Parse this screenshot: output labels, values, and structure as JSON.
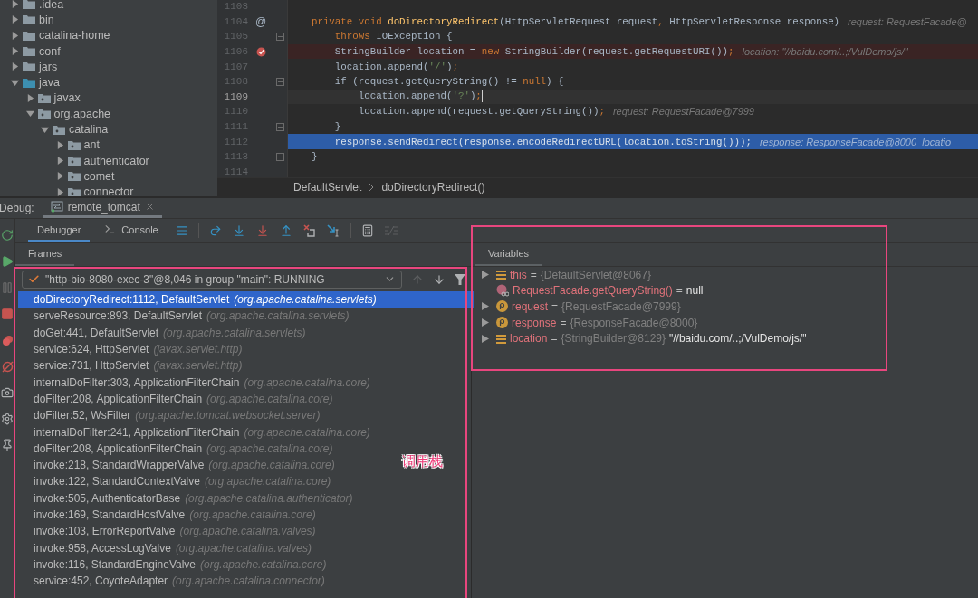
{
  "project_tree": [
    {
      "label": ".idea",
      "kind": "plain",
      "expanded": false
    },
    {
      "label": "bin",
      "kind": "plain",
      "expanded": false
    },
    {
      "label": "catalina-home",
      "kind": "plain",
      "expanded": false
    },
    {
      "label": "conf",
      "kind": "plain",
      "expanded": false
    },
    {
      "label": "jars",
      "kind": "plain",
      "expanded": false
    },
    {
      "label": "java",
      "kind": "source",
      "expanded": true,
      "children": [
        {
          "label": "javax",
          "kind": "package",
          "expanded": false
        },
        {
          "label": "org.apache",
          "kind": "package",
          "expanded": true,
          "children": [
            {
              "label": "catalina",
              "kind": "package",
              "expanded": true,
              "children": [
                {
                  "label": "ant",
                  "kind": "package",
                  "expanded": false
                },
                {
                  "label": "authenticator",
                  "kind": "package",
                  "expanded": false
                },
                {
                  "label": "comet",
                  "kind": "package",
                  "expanded": false
                },
                {
                  "label": "connector",
                  "kind": "package",
                  "expanded": false
                }
              ]
            }
          ]
        }
      ]
    }
  ],
  "editor": {
    "lines": [
      {
        "number": "1103",
        "execution": false,
        "caret": false,
        "breakpoint": false,
        "fold": false
      },
      {
        "number": "1104",
        "execution": false,
        "caret": false,
        "breakpoint": false,
        "fold": false,
        "gutter_mark": "@",
        "tokens": [
          {
            "kind": "kw",
            "text": "    private void "
          },
          {
            "kind": "fn",
            "text": "doDirectoryRedirect"
          },
          {
            "kind": "plain",
            "text": "(HttpServletRequest request"
          },
          {
            "kind": "punct",
            "text": ", "
          },
          {
            "kind": "plain",
            "text": "HttpServletResponse response)"
          }
        ],
        "hint": "request: RequestFacade@"
      },
      {
        "number": "1105",
        "execution": false,
        "caret": false,
        "breakpoint": false,
        "fold": true,
        "tokens": [
          {
            "kind": "kw",
            "text": "        throws "
          },
          {
            "kind": "plain",
            "text": "IOException {"
          }
        ]
      },
      {
        "number": "1106",
        "execution": false,
        "caret": false,
        "breakpoint": true,
        "fold": false,
        "tokens": [
          {
            "kind": "plain",
            "text": "        StringBuilder location = "
          },
          {
            "kind": "kw",
            "text": "new "
          },
          {
            "kind": "plain",
            "text": "StringBuilder(request.getRequestURI())"
          },
          {
            "kind": "punct",
            "text": ";"
          }
        ],
        "hint": "location: \"//baidu.com/..;/VulDemo/js/\""
      },
      {
        "number": "1107",
        "execution": false,
        "caret": false,
        "breakpoint": false,
        "fold": false,
        "tokens": [
          {
            "kind": "plain",
            "text": "        location.append("
          },
          {
            "kind": "str",
            "text": "'/'"
          },
          {
            "kind": "plain",
            "text": ")"
          },
          {
            "kind": "punct",
            "text": ";"
          }
        ]
      },
      {
        "number": "1108",
        "execution": false,
        "caret": false,
        "breakpoint": false,
        "fold": true,
        "tokens": [
          {
            "kind": "plain",
            "text": "        if (request.getQueryString() != "
          },
          {
            "kind": "kw",
            "text": "null"
          },
          {
            "kind": "plain",
            "text": ") {"
          }
        ]
      },
      {
        "number": "1109",
        "execution": false,
        "caret": true,
        "breakpoint": false,
        "fold": false,
        "tokens": [
          {
            "kind": "plain",
            "text": "            location.append("
          },
          {
            "kind": "str",
            "text": "'?'"
          },
          {
            "kind": "plain",
            "text": ")"
          },
          {
            "kind": "punct",
            "text": ";"
          }
        ]
      },
      {
        "number": "1110",
        "execution": false,
        "caret": false,
        "breakpoint": false,
        "fold": false,
        "tokens": [
          {
            "kind": "plain",
            "text": "            location.append(request.getQueryString())"
          },
          {
            "kind": "punct",
            "text": ";"
          }
        ],
        "hint": "request: RequestFacade@7999"
      },
      {
        "number": "1111",
        "execution": false,
        "caret": false,
        "breakpoint": false,
        "fold": true,
        "tokens": [
          {
            "kind": "plain",
            "text": "        }"
          }
        ]
      },
      {
        "number": "1112",
        "execution": true,
        "caret": false,
        "breakpoint": false,
        "fold": false,
        "tokens": [
          {
            "kind": "plain",
            "text": "        response.sendRedirect(response.encodeRedirectURL(location.toString()))"
          },
          {
            "kind": "punct",
            "text": ";"
          }
        ],
        "hint": "response: ResponseFacade@8000  locatio"
      },
      {
        "number": "1113",
        "execution": false,
        "caret": false,
        "breakpoint": false,
        "fold": true,
        "tokens": [
          {
            "kind": "plain",
            "text": "    }"
          }
        ]
      },
      {
        "number": "1114",
        "execution": false,
        "caret": false,
        "breakpoint": false,
        "fold": false
      }
    ],
    "breadcrumbs": [
      "DefaultServlet",
      "doDirectoryRedirect()"
    ]
  },
  "debug": {
    "label": "Debug:",
    "sessions": [
      {
        "label": "remote_tomcat",
        "selected": true
      }
    ],
    "tabs": [
      {
        "label": "Debugger",
        "kind": "debugger",
        "selected": true
      },
      {
        "label": "Console",
        "kind": "console",
        "selected": false
      }
    ],
    "frames_title": "Frames",
    "thread": "\"http-bio-8080-exec-3\"@8,046 in group \"main\": RUNNING",
    "frames": [
      {
        "frame": "doDirectoryRedirect:1112, DefaultServlet",
        "package": "(org.apache.catalina.servlets)",
        "selected": true
      },
      {
        "frame": "serveResource:893, DefaultServlet",
        "package": "(org.apache.catalina.servlets)",
        "selected": false
      },
      {
        "frame": "doGet:441, DefaultServlet",
        "package": "(org.apache.catalina.servlets)",
        "selected": false
      },
      {
        "frame": "service:624, HttpServlet",
        "package": "(javax.servlet.http)",
        "selected": false
      },
      {
        "frame": "service:731, HttpServlet",
        "package": "(javax.servlet.http)",
        "selected": false
      },
      {
        "frame": "internalDoFilter:303, ApplicationFilterChain",
        "package": "(org.apache.catalina.core)",
        "selected": false
      },
      {
        "frame": "doFilter:208, ApplicationFilterChain",
        "package": "(org.apache.catalina.core)",
        "selected": false
      },
      {
        "frame": "doFilter:52, WsFilter",
        "package": "(org.apache.tomcat.websocket.server)",
        "selected": false
      },
      {
        "frame": "internalDoFilter:241, ApplicationFilterChain",
        "package": "(org.apache.catalina.core)",
        "selected": false
      },
      {
        "frame": "doFilter:208, ApplicationFilterChain",
        "package": "(org.apache.catalina.core)",
        "selected": false
      },
      {
        "frame": "invoke:218, StandardWrapperValve",
        "package": "(org.apache.catalina.core)",
        "selected": false
      },
      {
        "frame": "invoke:122, StandardContextValve",
        "package": "(org.apache.catalina.core)",
        "selected": false
      },
      {
        "frame": "invoke:505, AuthenticatorBase",
        "package": "(org.apache.catalina.authenticator)",
        "selected": false
      },
      {
        "frame": "invoke:169, StandardHostValve",
        "package": "(org.apache.catalina.core)",
        "selected": false
      },
      {
        "frame": "invoke:103, ErrorReportValve",
        "package": "(org.apache.catalina.valves)",
        "selected": false
      },
      {
        "frame": "invoke:958, AccessLogValve",
        "package": "(org.apache.catalina.valves)",
        "selected": false
      },
      {
        "frame": "invoke:116, StandardEngineValve",
        "package": "(org.apache.catalina.core)",
        "selected": false
      },
      {
        "frame": "service:452, CoyoteAdapter",
        "package": "(org.apache.catalina.connector)",
        "selected": false
      }
    ],
    "variables_title": "Variables",
    "variables": [
      {
        "kind": "field",
        "name": "this",
        "operator": "=",
        "ref": "{DefaultServlet@8067}",
        "expandable": true
      },
      {
        "kind": "method",
        "name": "RequestFacade.getQueryString()",
        "operator": "=",
        "value": "null",
        "expandable": false
      },
      {
        "kind": "param",
        "name": "request",
        "operator": "=",
        "ref": "{RequestFacade@7999}",
        "expandable": true
      },
      {
        "kind": "param",
        "name": "response",
        "operator": "=",
        "ref": "{ResponseFacade@8000}",
        "expandable": true
      },
      {
        "kind": "field",
        "name": "location",
        "operator": "=",
        "ref": "{StringBuilder@8129}",
        "value": "\"//baidu.com/..;/VulDemo/js/\"",
        "expandable": true
      }
    ]
  },
  "annotation_label": "调用栈"
}
